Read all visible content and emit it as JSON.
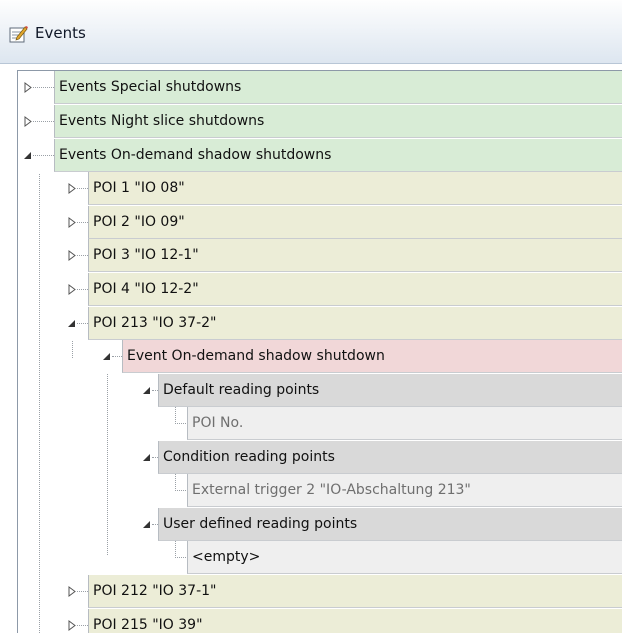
{
  "window": {
    "title": "Events"
  },
  "tree": {
    "groups": [
      {
        "label": "Events Special shutdowns",
        "state": "collapsed"
      },
      {
        "label": "Events Night slice shutdowns",
        "state": "collapsed"
      },
      {
        "label": "Events On-demand shadow shutdowns",
        "state": "expanded"
      }
    ],
    "pois": [
      {
        "label": "POI 1 \"IO 08\"",
        "state": "collapsed"
      },
      {
        "label": "POI 2 \"IO 09\"",
        "state": "collapsed"
      },
      {
        "label": "POI 3 \"IO 12-1\"",
        "state": "collapsed"
      },
      {
        "label": "POI 4 \"IO 12-2\"",
        "state": "collapsed"
      },
      {
        "label": "POI 213 \"IO 37-2\"",
        "state": "expanded"
      },
      {
        "label": "POI 212 \"IO 37-1\"",
        "state": "collapsed"
      },
      {
        "label": "POI 215 \"IO 39\"",
        "state": "collapsed"
      }
    ],
    "event": {
      "label": "Event On-demand shadow shutdown",
      "state": "expanded"
    },
    "reading_groups": [
      {
        "label": "Default reading points",
        "state": "expanded",
        "child": "POI No."
      },
      {
        "label": "Condition reading points",
        "state": "expanded",
        "child": "External trigger 2 \"IO-Abschaltung 213\""
      },
      {
        "label": "User defined reading points",
        "state": "expanded",
        "child": "<empty>"
      }
    ]
  },
  "colors": {
    "event_group": "#d8ecd6",
    "poi": "#ecedd7",
    "event": "#f1d7d8",
    "reading_group": "#d9d9d9",
    "reading_point": "#efefef"
  }
}
